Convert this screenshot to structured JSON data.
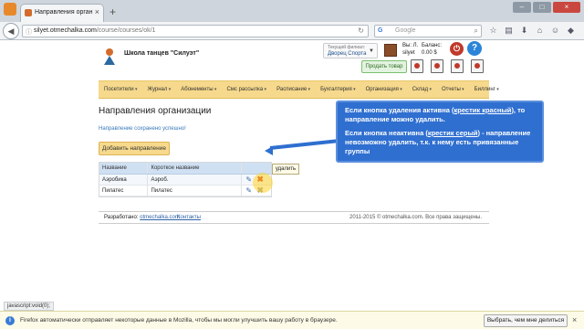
{
  "browser": {
    "tab_title": "Направления организаци...",
    "url_host": "silyet.otmechalka.com",
    "url_path": "/course/courses/ok/1",
    "search_engine": "G",
    "search_placeholder": "Google"
  },
  "header": {
    "site_name": "Школа танцев \"Силуэт\"",
    "branch_label": "Текущий филиал:",
    "branch_value": "Дворец Спорта",
    "user_name": "Вы: Л.",
    "user_login": "silyet",
    "balance_label": "Баланс:",
    "balance_value": "0.00 $",
    "sell_button": "Продать товар"
  },
  "menu": [
    "Посетители",
    "Журнал",
    "Абонементы",
    "Смс рассылка",
    "Расписание",
    "Бухгалтерия",
    "Организация",
    "Склад",
    "Отчеты",
    "Биллинг"
  ],
  "main": {
    "title": "Направления организации",
    "success_message": "Направление сохранено успешно!",
    "add_button": "Добавить направление",
    "columns": [
      "Название",
      "Короткое название"
    ],
    "rows": [
      {
        "name": "Аэробика",
        "short": "Аэроб."
      },
      {
        "name": "Пилатес",
        "short": "Пилатес"
      }
    ],
    "tooltip": "удалить"
  },
  "footer": {
    "developed_by": "Разработано:",
    "developer_link": "otmechalka.com",
    "contacts": "Контакты",
    "copyright": "2011-2015 © otmechalka.com. Все права защищены."
  },
  "callout": {
    "p1_before": "Если кнопка удаления активна (",
    "p1_link": "крестик красный",
    "p1_after": "), то направление можно удалить.",
    "p2_before": "Если кнопка неактивна (",
    "p2_link": "крестик серый",
    "p2_after": ") - направление невозможно удалить, т.к. к нему есть привязанные группы"
  },
  "status_bar": "javascript:void(0);",
  "notification": {
    "text": "Firefox автоматически отправляет некоторые данные в Mozilla, чтобы мы могли улучшить вашу работу в браузере.",
    "button": "Выбрать, чем мне делиться"
  }
}
